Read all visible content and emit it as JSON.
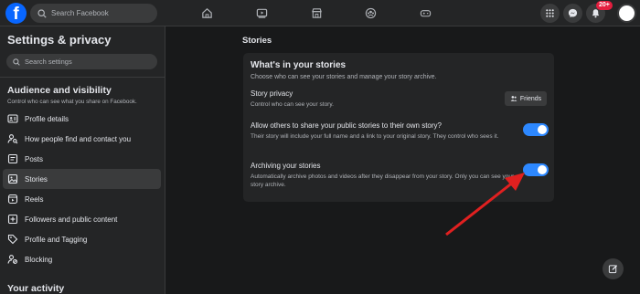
{
  "topbar": {
    "logo_letter": "f",
    "search_placeholder": "Search Facebook",
    "nav_icons": [
      "home-icon",
      "video-icon",
      "marketplace-icon",
      "groups-icon",
      "gaming-icon"
    ],
    "right_icons": [
      "menu-grid-icon",
      "messenger-icon",
      "bell-icon"
    ],
    "notification_badge": "20+"
  },
  "sidebar": {
    "title": "Settings & privacy",
    "search_placeholder": "Search settings",
    "section_title": "Audience and visibility",
    "section_subtitle": "Control who can see what you share on Facebook.",
    "items": [
      {
        "label": "Profile details",
        "icon": "profile-card-icon"
      },
      {
        "label": "How people find and contact you",
        "icon": "person-search-icon"
      },
      {
        "label": "Posts",
        "icon": "posts-icon"
      },
      {
        "label": "Stories",
        "icon": "stories-icon"
      },
      {
        "label": "Reels",
        "icon": "reels-icon"
      },
      {
        "label": "Followers and public content",
        "icon": "followers-icon"
      },
      {
        "label": "Profile and Tagging",
        "icon": "tag-icon"
      },
      {
        "label": "Blocking",
        "icon": "block-icon"
      }
    ],
    "active_item": "Stories",
    "next_section_title": "Your activity"
  },
  "main": {
    "page_title": "Stories",
    "card": {
      "title": "What's in your stories",
      "subtitle": "Choose who can see your stories and manage your story archive.",
      "story_privacy": {
        "title": "Story privacy",
        "desc": "Control who can see your story.",
        "button_label": "Friends"
      },
      "allow_share": {
        "title": "Allow others to share your public stories to their own story?",
        "desc": "Their story will include your full name and a link to your original story. They control who sees it.",
        "enabled": true
      },
      "archiving": {
        "title": "Archiving your stories",
        "desc": "Automatically archive photos and videos after they disappear from your story. Only you can see your story archive.",
        "enabled": true
      }
    }
  },
  "colors": {
    "accent": "#2d88ff",
    "brand": "#0866ff",
    "arrow": "#e02020",
    "badge": "#e41e3f"
  }
}
